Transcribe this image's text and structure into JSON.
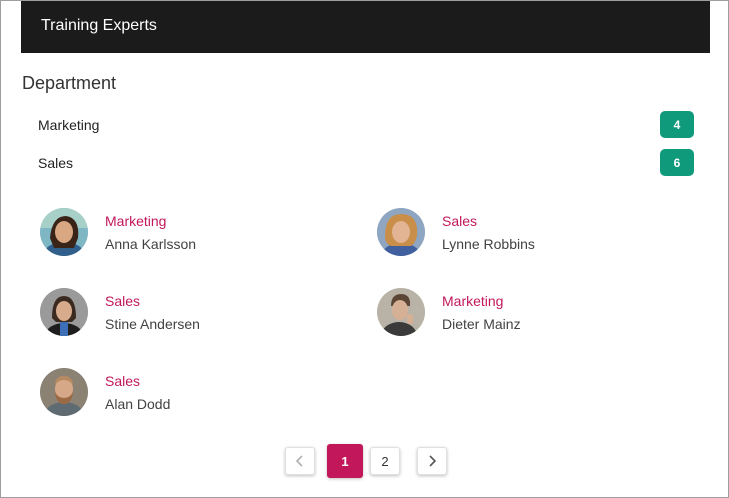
{
  "header": {
    "title": "Training Experts"
  },
  "section": {
    "title": "Department"
  },
  "departments": [
    {
      "label": "Marketing",
      "count": "4"
    },
    {
      "label": "Sales",
      "count": "6"
    }
  ],
  "experts": [
    {
      "department": "Marketing",
      "name": "Anna Karlsson"
    },
    {
      "department": "Sales",
      "name": "Lynne Robbins"
    },
    {
      "department": "Sales",
      "name": "Stine Andersen"
    },
    {
      "department": "Marketing",
      "name": "Dieter Mainz"
    },
    {
      "department": "Sales",
      "name": "Alan Dodd"
    }
  ],
  "pager": {
    "prev_icon": "chevron-left-icon",
    "next_icon": "chevron-right-icon",
    "pages": [
      "1",
      "2"
    ],
    "current": "1"
  },
  "colors": {
    "header_bg": "#1b1b1b",
    "badge": "#0f9a7c",
    "accent": "#c2185b"
  }
}
